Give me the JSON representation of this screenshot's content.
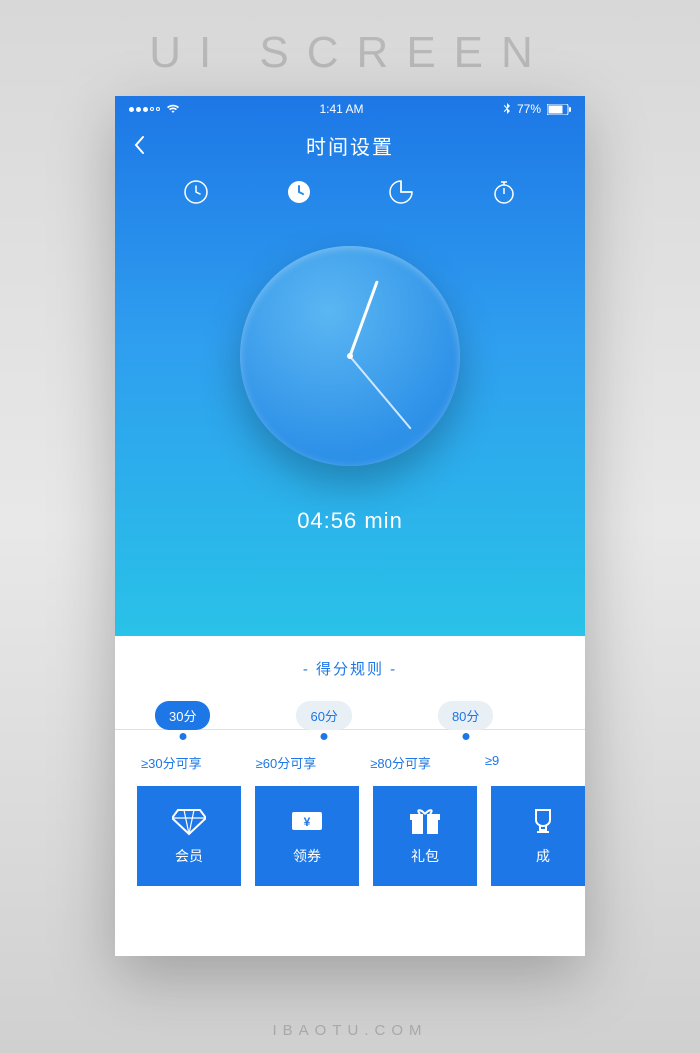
{
  "hero": {
    "title": "UI SCREEN"
  },
  "status_bar": {
    "time": "1:41 AM",
    "battery_pct": "77%"
  },
  "nav": {
    "title": "时间设置"
  },
  "clock": {
    "time_label": "04:56 min"
  },
  "rules": {
    "title": "得分规则",
    "pills": [
      {
        "label": "30分",
        "active": true
      },
      {
        "label": "60分",
        "active": false
      },
      {
        "label": "80分",
        "active": false
      }
    ],
    "thresholds": [
      "≥30分可享",
      "≥60分可享",
      "≥80分可享",
      "≥9"
    ]
  },
  "rewards": [
    {
      "icon": "diamond",
      "label": "会员"
    },
    {
      "icon": "coupon",
      "label": "领券"
    },
    {
      "icon": "gift",
      "label": "礼包"
    },
    {
      "icon": "trophy",
      "label": "成"
    }
  ],
  "footer": {
    "text": "IBAOTU.COM"
  }
}
